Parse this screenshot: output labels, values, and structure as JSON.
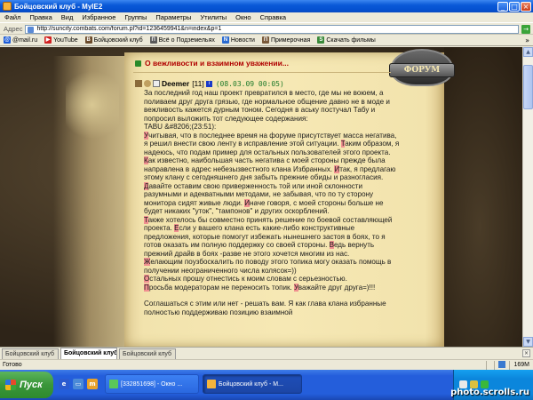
{
  "window": {
    "title": "Бойцовский клуб - MyIE2"
  },
  "menu": {
    "items": [
      "Файл",
      "Правка",
      "Вид",
      "Избранное",
      "Группы",
      "Параметры",
      "Утилиты",
      "Окно",
      "Справка"
    ]
  },
  "address": {
    "label": "Адрес",
    "url": "http://suncity.combats.com/forum.pl?id=1236459941&n=index&p=1"
  },
  "links": {
    "items": [
      {
        "label": "@mail.ru",
        "color": "#1a5ad8",
        "glyph": "@"
      },
      {
        "label": "YouTube",
        "color": "#d02020",
        "glyph": "▶"
      },
      {
        "label": "Бойцовский клуб",
        "color": "#6a4a2a",
        "glyph": "B"
      },
      {
        "label": "Всё о Подземельях",
        "color": "#5a5a5a",
        "glyph": "П"
      },
      {
        "label": "Новости",
        "color": "#2a6ad0",
        "glyph": "N"
      },
      {
        "label": "Примерочная",
        "color": "#7a5a3a",
        "glyph": "П"
      },
      {
        "label": "Скачать фильмы",
        "color": "#3a8a3a",
        "glyph": "S"
      }
    ],
    "more": "»"
  },
  "forum": {
    "badge_label": "ФОРУМ",
    "topic_title": "О вежливости и взаимном уважении...",
    "post": {
      "author": "Deemer",
      "level": "[11]",
      "info_glyph": "i",
      "date": "(08.03.09 00:05)",
      "intro": "За последний год наш проект превратился в место, где мы не воюем, а поливаем друг друга грязью, где нормальное общение давно не в моде и вежливость кажется дурным тоном. Сегодня в аську постучал Табу и попросил выложить тот следующее содержания:",
      "quote_header": "TABU &#8206;(23:51):",
      "paragraph_1_hl": "У",
      "paragraph_1_a": "читывая, что в последнее время на форуме присутствует масса негатива, я решил внести свою ленту в исправление этой ситуации. ",
      "paragraph_1_hl2": "Т",
      "paragraph_1_b": "аким образом, я надеюсь, что подам пример для остальных пользователей этого проекта.",
      "paragraph_2_hl": "К",
      "paragraph_2_a": "ак известно, наибольшая часть негатива с моей стороны прежде была направлена в адрес небезызвестного клана Избранных. ",
      "paragraph_2_hl2": "И",
      "paragraph_2_b": "так, я предлагаю этому клану с сегодняшнего дня забыть прежние обиды и разногласия. ",
      "paragraph_2_hl3": "Д",
      "paragraph_2_c": "авайте оставим свою приверженность той или иной склонности разумными и адекватными методами, не забывая, что по ту сторону монитора сидят живые люди. ",
      "paragraph_2_hl4": "И",
      "paragraph_2_d": "наче говоря, с моей стороны больше не будет никаких \"уток\", \"тампонов\" и других оскорблений.",
      "paragraph_3_hl": "Т",
      "paragraph_3_a": "акже хотелось бы совместно принять решение по боевой составляющей проекта. ",
      "paragraph_3_hl2": "Е",
      "paragraph_3_b": "сли у вашего клана есть какие-либо конструктивные предложения, которые помогут избежать нынешнего застоя в боях, то я готов оказать им полную поддержку со своей стороны. ",
      "paragraph_3_hl3": "В",
      "paragraph_3_c": "едь вернуть прежний драйв в боях -разве не этого хочется многим из нас.",
      "paragraph_4_hl": "Ж",
      "paragraph_4_a": "елающим поузбоскалить по поводу этого топика могу оказать помощь в получении неограниченного числа колясок=))",
      "paragraph_5_hl": "О",
      "paragraph_5_a": "стальных прошу отнестись к моим словам с серьезностью.",
      "paragraph_6_hl": "П",
      "paragraph_6_a": "росьба модераторам не переносить топик. ",
      "paragraph_6_hl2": "У",
      "paragraph_6_b": "важайте друг друга=)!!!",
      "outro": "Соглашаться с этим или нет - решать вам. Я как глава клана избранные полностью поддерживаю позицию взаимной"
    }
  },
  "tabs": {
    "items": [
      "Бойцовский клуб",
      "Бойцовский клуб",
      "Бойцовский клуб"
    ],
    "active_index": 1,
    "close_glyph": "×"
  },
  "status": {
    "text": "Готово",
    "memory": "169M"
  },
  "taskbar": {
    "start_label": "Пуск",
    "tasks": [
      {
        "label": "[332851698] - Окно ..."
      },
      {
        "label": "Бойцовский клуб - M..."
      }
    ],
    "watermark": "photo.scrolls.ru"
  },
  "colors": {
    "xp_blue": "#245edb",
    "topic_red": "#b00000",
    "date_green": "#1e7a2a",
    "highlight": "#f09090"
  }
}
